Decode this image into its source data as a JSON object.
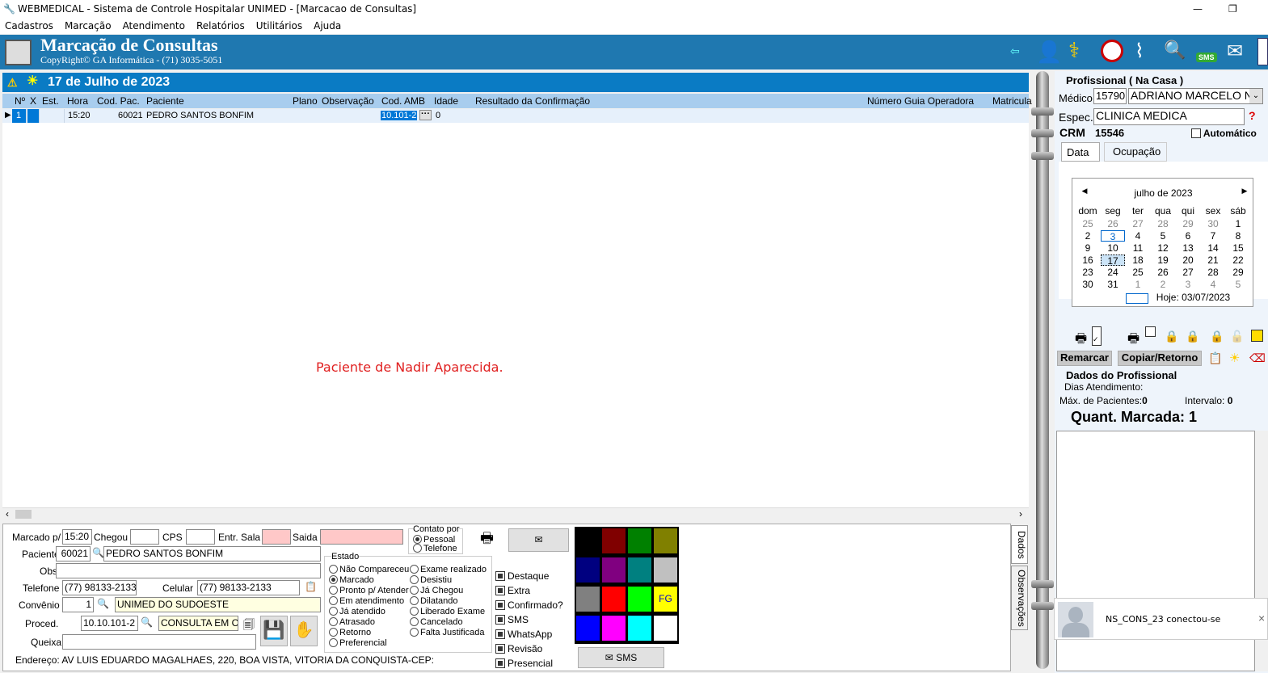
{
  "window": {
    "title": "WEBMEDICAL - Sistema de Controle Hospitalar UNIMED - [Marcacao de Consultas]",
    "minimize": "—",
    "maximize": "❐"
  },
  "menu": [
    "Cadastros",
    "Marcação",
    "Atendimento",
    "Relatórios",
    "Utilitários",
    "Ajuda"
  ],
  "banner": {
    "title": "Marcação de Consultas",
    "copyright": "CopyRight© GA Informática - (71) 3035-5051"
  },
  "date_header": "17 de Julho de 2023",
  "grid": {
    "columns": [
      "Nº",
      "X",
      "Est.",
      "Hora",
      "Cod. Pac.",
      "Paciente",
      "Plano",
      "Observação",
      "Cod. AMB",
      "Idade",
      "Resultado da Confirmação",
      "Número Guia Operadora",
      "Matricula"
    ],
    "rows": [
      {
        "num": "1",
        "x": "",
        "est": "",
        "hora": "15:20",
        "cod_pac": "60021",
        "paciente": "PEDRO SANTOS BONFIM",
        "plano": "",
        "obs": "",
        "cod_amb": "10.101-2",
        "idade": "0",
        "resultado": "",
        "guia": "",
        "matricula": ""
      }
    ],
    "message": "Paciente de Nadir Aparecida.",
    "message_color": "#e02020"
  },
  "form": {
    "marcado_label": "Marcado p/",
    "marcado": "15:20",
    "chegou_label": "Chegou",
    "chegou": "",
    "cps_label": "CPS",
    "cps": "",
    "entr_label": "Entr. Sala",
    "entr": "",
    "saida_label": "Saida",
    "saida": "",
    "paciente_label": "Paciente",
    "paciente_cod": "60021",
    "paciente_nome": "PEDRO SANTOS BONFIM",
    "obs_label": "Obs.",
    "obs": "",
    "telefone_label": "Telefone",
    "telefone": "(77) 98133-2133",
    "celular_label": "Celular",
    "celular": "(77) 98133-2133",
    "convenio_label": "Convênio",
    "convenio_cod": "1",
    "convenio_nome": "UNIMED DO SUDOESTE",
    "proced_label": "Proced.",
    "proced_cod": "10.10.101-2",
    "proced_nome": "CONSULTA EM C",
    "queixa_label": "Queixa",
    "queixa": "",
    "endereco": "Endereço: AV LUIS EDUARDO MAGALHAES, 220, BOA VISTA, VITORIA DA CONQUISTA-CEP:",
    "contato": {
      "label": "Contato por",
      "options": [
        "Pessoal",
        "Telefone"
      ],
      "selected": "Pessoal"
    },
    "estado": {
      "label": "Estado",
      "col1": [
        "Não Compareceu",
        "Marcado",
        "Pronto p/ Atender",
        "Em atendimento",
        "Já atendido",
        "Atrasado",
        "Retorno",
        "Preferencial"
      ],
      "col2": [
        "Exame realizado",
        "Desistiu",
        "Já Chegou",
        "Dilatando",
        "Liberado Exame",
        "Cancelado",
        "Falta Justificada"
      ],
      "selected": "Marcado"
    },
    "checks": [
      "Destaque",
      "Extra",
      "Confirmado?",
      "SMS",
      "WhatsApp",
      "Revisão",
      "Presencial"
    ],
    "colors": [
      "#000000",
      "#800000",
      "#008000",
      "#808000",
      "#000080",
      "#800080",
      "#008080",
      "#c0c0c0",
      "#808080",
      "#ff0000",
      "#00ff00",
      "#ffff00",
      "#0000ff",
      "#ff00ff",
      "#00ffff",
      "#ffffff"
    ],
    "fg_label": "FG",
    "sms_button": "SMS",
    "tabs": [
      "Dados",
      "Observações"
    ]
  },
  "right": {
    "group_label": "Profissional ( Na Casa )",
    "medico_label": "Médico",
    "medico_cod": "15790",
    "medico_nome": "ADRIANO MARCELO NC",
    "espec_label": "Espec.",
    "espec": "CLINICA MEDICA",
    "crm_label": "CRM",
    "crm": "15546",
    "automatico_label": "Automático",
    "tabs": [
      "Data",
      "Ocupação"
    ],
    "calendar": {
      "month": "julho de 2023",
      "weekdays": [
        "dom",
        "seg",
        "ter",
        "qua",
        "qui",
        "sex",
        "sáb"
      ],
      "weeks": [
        [
          "25",
          "26",
          "27",
          "28",
          "29",
          "30",
          "1"
        ],
        [
          "2",
          "3",
          "4",
          "5",
          "6",
          "7",
          "8"
        ],
        [
          "9",
          "10",
          "11",
          "12",
          "13",
          "14",
          "15"
        ],
        [
          "16",
          "17",
          "18",
          "19",
          "20",
          "21",
          "22"
        ],
        [
          "23",
          "24",
          "25",
          "26",
          "27",
          "28",
          "29"
        ],
        [
          "30",
          "31",
          "1",
          "2",
          "3",
          "4",
          "5"
        ]
      ],
      "selected": "17",
      "today_label": "Hoje: 03/07/2023"
    },
    "remarcar": "Remarcar",
    "copiar": "Copiar/Retorno",
    "dados_label": "Dados do Profissional",
    "dias_label": "Dias Atendimento:",
    "max_label": "Máx. de Pacientes:",
    "max": "0",
    "intervalo_label": "Intervalo:",
    "intervalo": "0",
    "quant": "Quant. Marcada: 1"
  },
  "toast": {
    "text": "NS_CONS_23 conectou-se",
    "close": "×"
  }
}
